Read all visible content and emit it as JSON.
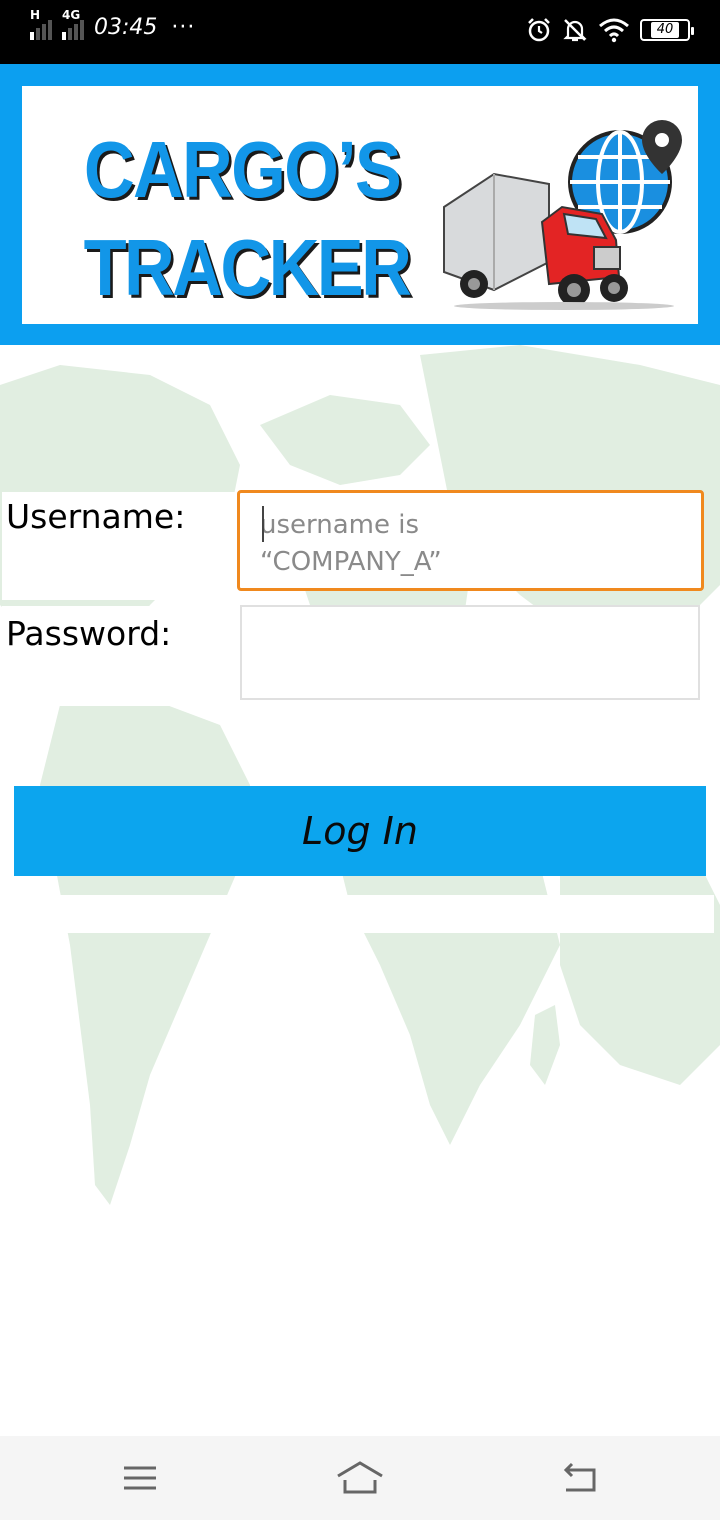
{
  "status_bar": {
    "network_h": "H",
    "network_4g": "4G",
    "time": "03:45",
    "more": "···",
    "battery": "40",
    "icons": [
      "alarm-icon",
      "mute-bell-icon",
      "wifi-icon",
      "battery-icon"
    ]
  },
  "header": {
    "logo_line1": "CARGO’S",
    "logo_line2": "TRACKER",
    "brand_color": "#0c9ff0"
  },
  "form": {
    "username_label": "Username:",
    "username_placeholder": "username is\n“COMPANY_A”",
    "username_value": "",
    "password_label": "Password:",
    "password_value": "",
    "focus_color": "#f0891e"
  },
  "login_button": {
    "label": "Log In",
    "color": "#0ca5ee"
  },
  "nav_bar": {
    "icons": [
      "menu-icon",
      "home-icon",
      "back-icon"
    ]
  }
}
